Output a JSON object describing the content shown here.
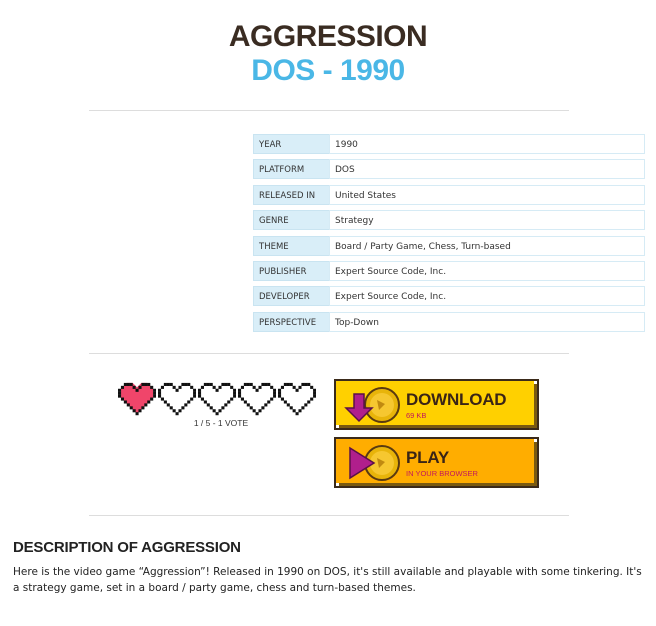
{
  "header": {
    "title": "AGGRESSION",
    "subtitle": "DOS - 1990"
  },
  "info_table": [
    {
      "key": "YEAR",
      "value": "1990"
    },
    {
      "key": "PLATFORM",
      "value": "DOS"
    },
    {
      "key": "RELEASED IN",
      "value": "United States"
    },
    {
      "key": "GENRE",
      "value": "Strategy"
    },
    {
      "key": "THEME",
      "value": "Board / Party Game, Chess, Turn-based"
    },
    {
      "key": "PUBLISHER",
      "value": "Expert Source Code, Inc."
    },
    {
      "key": "DEVELOPER",
      "value": "Expert Source Code, Inc."
    },
    {
      "key": "PERSPECTIVE",
      "value": "Top-Down"
    }
  ],
  "rating": {
    "filled": 1,
    "total": 5,
    "text": "1 / 5 - 1 VOTE",
    "filled_color": "#f0456a",
    "empty_color": "#ffffff"
  },
  "download_button": {
    "label": "DOWNLOAD",
    "sublabel": "69 KB",
    "color": "#ffd000",
    "icon": "download-arrow-icon"
  },
  "play_button": {
    "label": "PLAY",
    "sublabel": "IN YOUR BROWSER",
    "color": "#ffad00",
    "icon": "play-triangle-icon"
  },
  "description": {
    "title": "DESCRIPTION OF AGGRESSION",
    "text": "Here is the video game “Aggression”! Released in 1990 on DOS, it's still available and playable with some tinkering. It's a strategy game, set in a board / party game, chess and turn-based themes."
  }
}
